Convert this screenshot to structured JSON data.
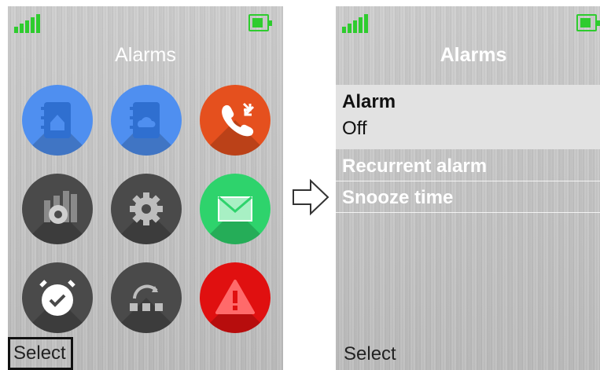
{
  "left_screen": {
    "title": "Alarms",
    "softkey_left": "Select",
    "apps": [
      {
        "name": "contacts-local-icon",
        "color": "#4f8ff0"
      },
      {
        "name": "contacts-cloud-icon",
        "color": "#4f8ff0"
      },
      {
        "name": "call-list-icon",
        "color": "#e5501e"
      },
      {
        "name": "device-settings-icon",
        "color": "#4a4a4a"
      },
      {
        "name": "settings-icon",
        "color": "#4a4a4a"
      },
      {
        "name": "messaging-icon",
        "color": "#2ed36c"
      },
      {
        "name": "alarm-clock-icon",
        "color": "#4a4a4a"
      },
      {
        "name": "connections-icon",
        "color": "#4a4a4a"
      },
      {
        "name": "alert-icon",
        "color": "#e01010"
      }
    ]
  },
  "right_screen": {
    "title": "Alarms",
    "softkey_left": "Select",
    "menu": [
      {
        "label": "Alarm",
        "value": "Off",
        "selected": true
      },
      {
        "label": "Recurrent alarm"
      },
      {
        "label": "Snooze time"
      }
    ]
  },
  "colors": {
    "status_green": "#2ecc2e",
    "selection_bg": "#e2e2e2"
  }
}
